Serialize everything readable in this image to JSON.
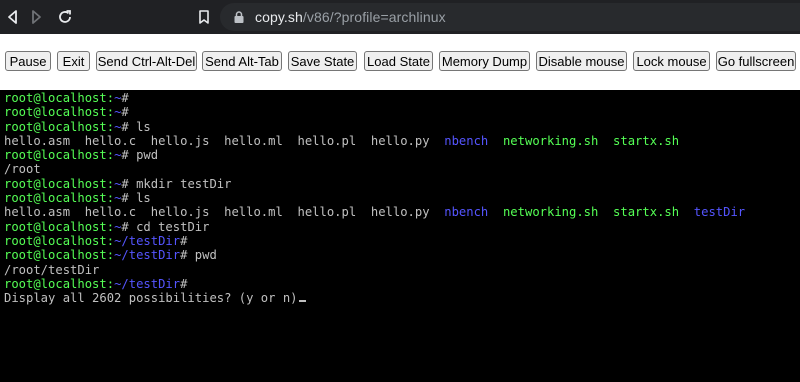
{
  "browser": {
    "url_host": "copy.sh",
    "url_path": "/v86/?profile=archlinux"
  },
  "toolbar": {
    "buttons": [
      {
        "label": "Pause"
      },
      {
        "label": "Exit"
      },
      {
        "label": "Send Ctrl-Alt-Del"
      },
      {
        "label": "Send Alt-Tab"
      },
      {
        "label": "Save State"
      },
      {
        "label": "Load State"
      },
      {
        "label": "Memory Dump"
      },
      {
        "label": "Disable mouse"
      },
      {
        "label": "Lock mouse"
      },
      {
        "label": "Go fullscreen"
      }
    ]
  },
  "terminal": {
    "colors": {
      "prompt": "#55ff55",
      "dir": "#5555ff",
      "exec": "#55ff55",
      "text": "#c0c0c0"
    },
    "lines": [
      [
        {
          "t": "root@localhost:",
          "c": "pr"
        },
        {
          "t": "~",
          "c": "tl"
        },
        {
          "t": "#",
          "c": ""
        }
      ],
      [
        {
          "t": "root@localhost:",
          "c": "pr"
        },
        {
          "t": "~",
          "c": "tl"
        },
        {
          "t": "#",
          "c": ""
        }
      ],
      [
        {
          "t": "root@localhost:",
          "c": "pr"
        },
        {
          "t": "~",
          "c": "tl"
        },
        {
          "t": "# ls",
          "c": ""
        }
      ],
      [
        {
          "t": "hello.asm  hello.c  hello.js  hello.ml  hello.pl  hello.py  ",
          "c": ""
        },
        {
          "t": "nbench",
          "c": "dir"
        },
        {
          "t": "  ",
          "c": ""
        },
        {
          "t": "networking.sh",
          "c": "ex"
        },
        {
          "t": "  ",
          "c": ""
        },
        {
          "t": "startx.sh",
          "c": "ex"
        }
      ],
      [
        {
          "t": "root@localhost:",
          "c": "pr"
        },
        {
          "t": "~",
          "c": "tl"
        },
        {
          "t": "# pwd",
          "c": ""
        }
      ],
      [
        {
          "t": "/root",
          "c": ""
        }
      ],
      [
        {
          "t": "root@localhost:",
          "c": "pr"
        },
        {
          "t": "~",
          "c": "tl"
        },
        {
          "t": "# mkdir testDir",
          "c": ""
        }
      ],
      [
        {
          "t": "root@localhost:",
          "c": "pr"
        },
        {
          "t": "~",
          "c": "tl"
        },
        {
          "t": "# ls",
          "c": ""
        }
      ],
      [
        {
          "t": "hello.asm  hello.c  hello.js  hello.ml  hello.pl  hello.py  ",
          "c": ""
        },
        {
          "t": "nbench",
          "c": "dir"
        },
        {
          "t": "  ",
          "c": ""
        },
        {
          "t": "networking.sh",
          "c": "ex"
        },
        {
          "t": "  ",
          "c": ""
        },
        {
          "t": "startx.sh",
          "c": "ex"
        },
        {
          "t": "  ",
          "c": ""
        },
        {
          "t": "testDir",
          "c": "dir"
        }
      ],
      [
        {
          "t": "root@localhost:",
          "c": "pr"
        },
        {
          "t": "~",
          "c": "tl"
        },
        {
          "t": "# cd testDir",
          "c": ""
        }
      ],
      [
        {
          "t": "root@localhost:",
          "c": "pr"
        },
        {
          "t": "~/testDir",
          "c": "tl"
        },
        {
          "t": "#",
          "c": ""
        }
      ],
      [
        {
          "t": "root@localhost:",
          "c": "pr"
        },
        {
          "t": "~/testDir",
          "c": "tl"
        },
        {
          "t": "# pwd",
          "c": ""
        }
      ],
      [
        {
          "t": "/root/testDir",
          "c": ""
        }
      ],
      [
        {
          "t": "root@localhost:",
          "c": "pr"
        },
        {
          "t": "~/testDir",
          "c": "tl"
        },
        {
          "t": "#",
          "c": ""
        }
      ],
      [
        {
          "t": "Display all 2602 possibilities? (y or n)",
          "c": ""
        }
      ]
    ]
  }
}
